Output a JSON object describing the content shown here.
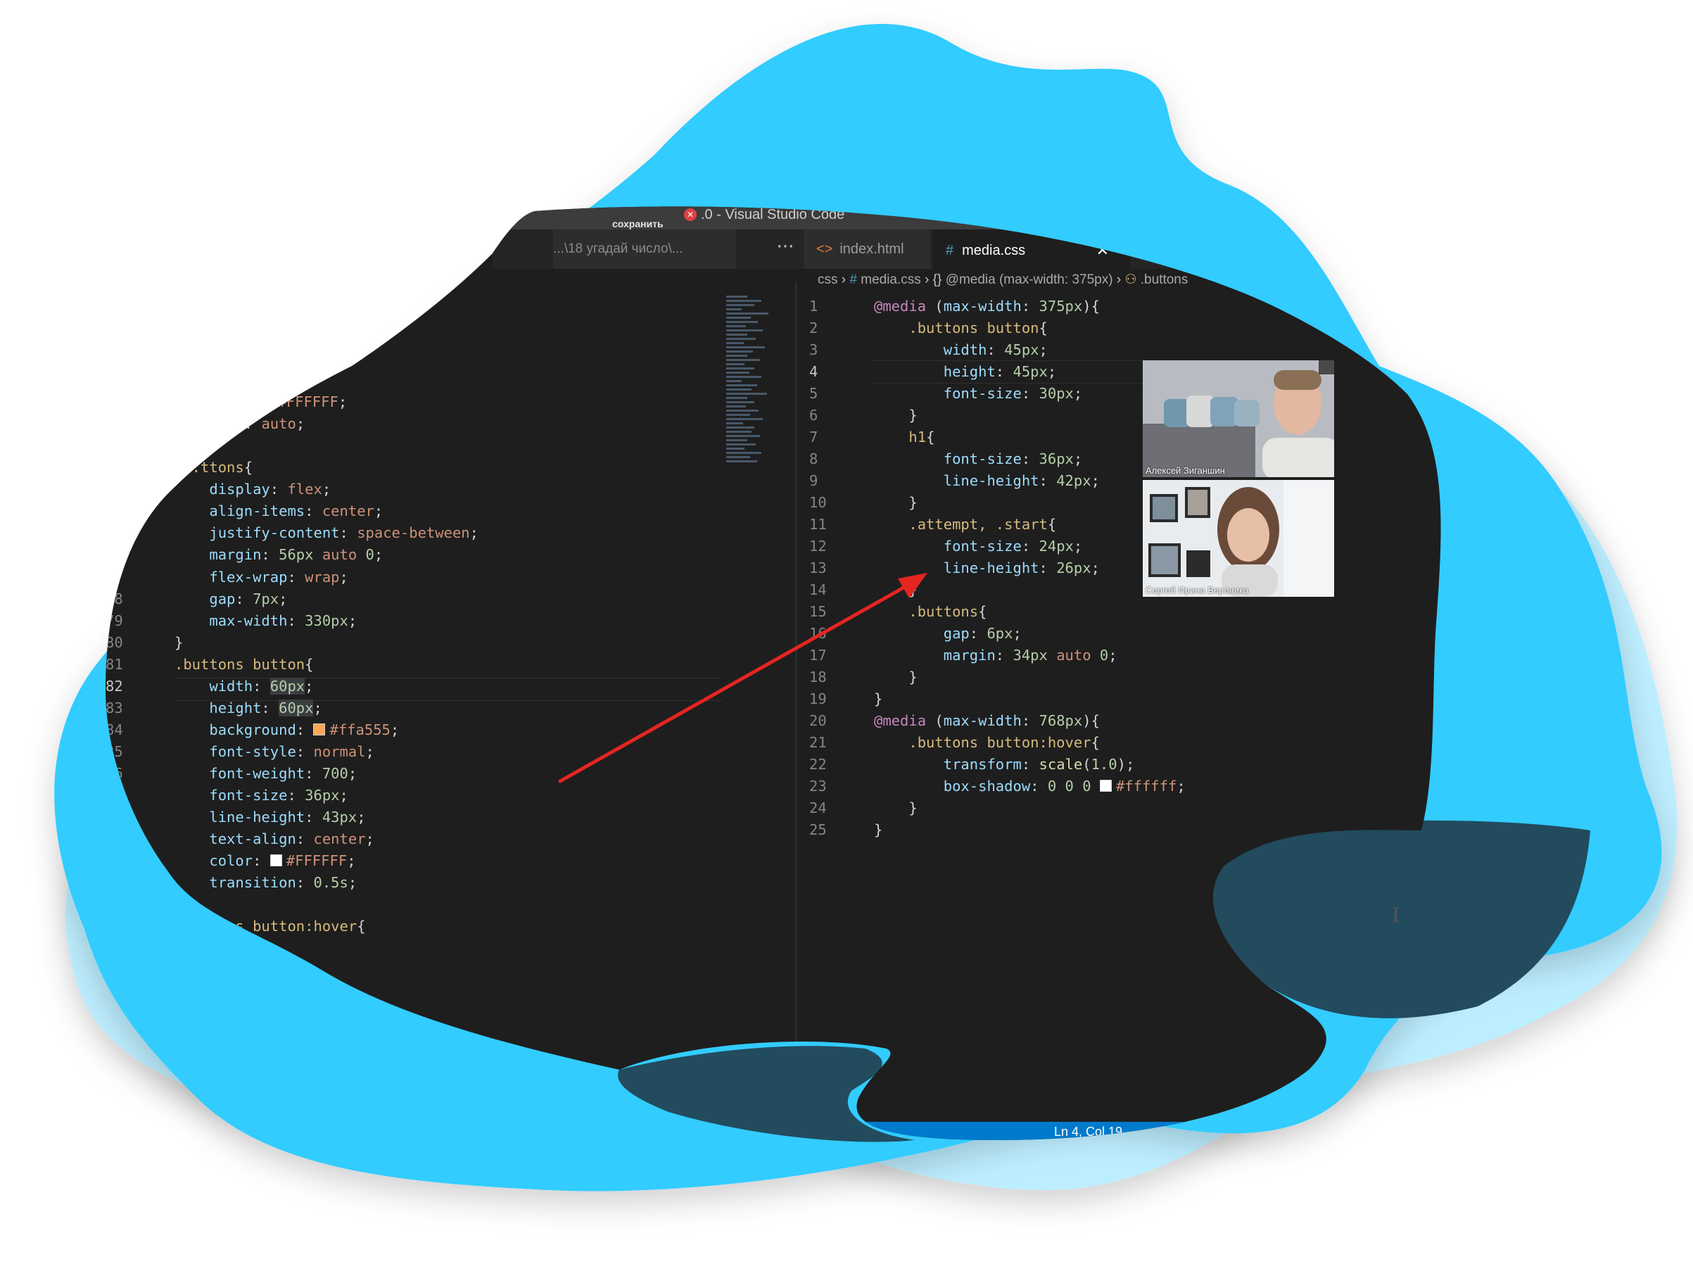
{
  "window": {
    "title": ".0 - Visual Studio Code",
    "save_label": "сохранить",
    "error_badge": "✕"
  },
  "tabs": {
    "left_tab_path": "...\\18 угадай число\\...",
    "more": "···",
    "index_tab": "index.html",
    "media_tab": "media.css",
    "close": "✕",
    "html_icon": "<>",
    "css_icon": "#"
  },
  "breadcrumb": {
    "folder": "css",
    "sep1": "›",
    "hash": "#",
    "file": "media.css",
    "sep2": "›",
    "braces": "{}",
    "rule": "@media (max-width: 375px)",
    "sep3": "›",
    "selector_icon": "⚇",
    "selector": ".buttons"
  },
  "left_code": [
    {
      "n": "",
      "text": "  ...und:  #FFFFFF;"
    },
    {
      "n": "",
      "text": "  ...gin: auto;"
    }
  ],
  "status": {
    "position": "Ln 4, Col 19"
  },
  "videos": [
    {
      "name": "Алексей Зиганшин"
    },
    {
      "name": "Сергей Ирина Вероника"
    }
  ],
  "colors": {
    "blob_main": "#33ccff",
    "blob_light": "#bdeeff",
    "blob_dark": "#224b5e",
    "editor_bg": "#1e1e1e",
    "arrow": "#e52521",
    "status_bar": "#007acc"
  }
}
